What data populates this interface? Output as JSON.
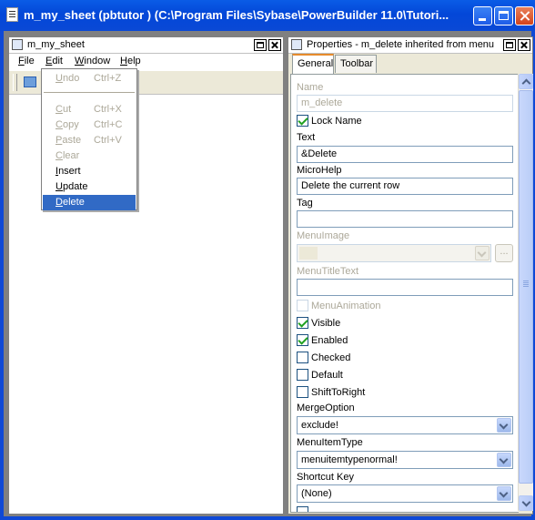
{
  "window": {
    "title": "m_my_sheet (pbtutor ) (C:\\Program Files\\Sybase\\PowerBuilder 11.0\\Tutori...",
    "icon": "document-icon"
  },
  "sheet": {
    "title": "m_my_sheet",
    "menubar": [
      "File",
      "Edit",
      "Window",
      "Help"
    ]
  },
  "edit_menu": {
    "items": [
      {
        "label": "Undo",
        "shortcut": "Ctrl+Z",
        "enabled": false
      },
      {
        "label": "Cut",
        "shortcut": "Ctrl+X",
        "enabled": false
      },
      {
        "label": "Copy",
        "shortcut": "Ctrl+C",
        "enabled": false
      },
      {
        "label": "Paste",
        "shortcut": "Ctrl+V",
        "enabled": false
      },
      {
        "label": "Clear",
        "shortcut": "",
        "enabled": false
      },
      {
        "label": "Insert",
        "shortcut": "",
        "enabled": true
      },
      {
        "label": "Update",
        "shortcut": "",
        "enabled": true
      },
      {
        "label": "Delete",
        "shortcut": "",
        "enabled": true,
        "selected": true
      }
    ]
  },
  "props": {
    "title": "Properties - m_delete  inherited  from  menu",
    "tabs": [
      "General",
      "Toolbar"
    ],
    "name_label": "Name",
    "name_value": "m_delete",
    "lock_name_label": "Lock Name",
    "text_label": "Text",
    "text_value": "&Delete",
    "microhelp_label": "MicroHelp",
    "microhelp_value": "Delete the current row",
    "tag_label": "Tag",
    "tag_value": "",
    "menuimage_label": "MenuImage",
    "ellipsis_label": "...",
    "menutitletext_label": "MenuTitleText",
    "menutitletext_value": "",
    "menuanimation_label": "MenuAnimation",
    "visible_label": "Visible",
    "enabled_label": "Enabled",
    "checked_label": "Checked",
    "default_label": "Default",
    "shifttoright_label": "ShiftToRight",
    "mergeoption_label": "MergeOption",
    "mergeoption_value": "exclude!",
    "menuitemtype_label": "MenuItemType",
    "menuitemtype_value": "menuitemtypenormal!",
    "shortcutkey_label": "Shortcut Key",
    "shortcutkey_value": "(None)"
  }
}
